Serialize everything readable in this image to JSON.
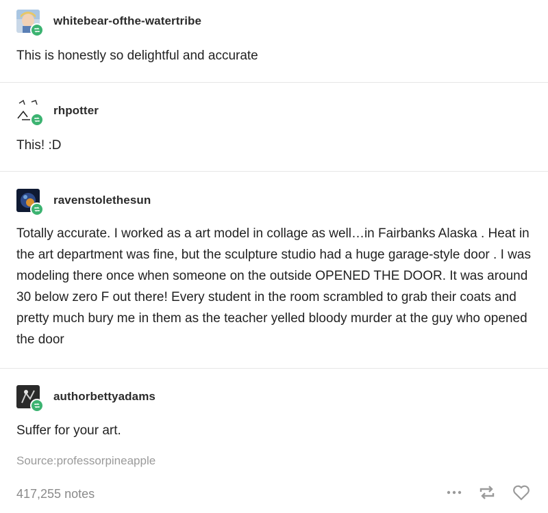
{
  "posts": [
    {
      "username": "whitebear-ofthe-watertribe",
      "text": "This is honestly so delightful and accurate"
    },
    {
      "username": "rhpotter",
      "text": "This! :D"
    },
    {
      "username": "ravenstolethesun",
      "text": "Totally accurate. I worked as a art model in collage as well…in Fairbanks Alaska . Heat in the art department was fine, but the sculpture studio had a huge garage-style door . I was modeling there once when someone on the outside OPENED THE DOOR. It was around 30 below zero F out there! Every student in the room scrambled to grab their coats and pretty much bury me in them as the teacher yelled bloody murder at the guy who opened the door"
    },
    {
      "username": "authorbettyadams",
      "text": "Suffer for your art."
    }
  ],
  "source": "Source:professorpineapple",
  "footer": {
    "notes": "417,255 notes",
    "icons": [
      "more-icon",
      "reblog-icon",
      "heart-icon"
    ]
  },
  "colors": {
    "reblog_badge": "#3cb371",
    "divider": "#e6e6e6",
    "muted_text": "#8a8a8a"
  }
}
